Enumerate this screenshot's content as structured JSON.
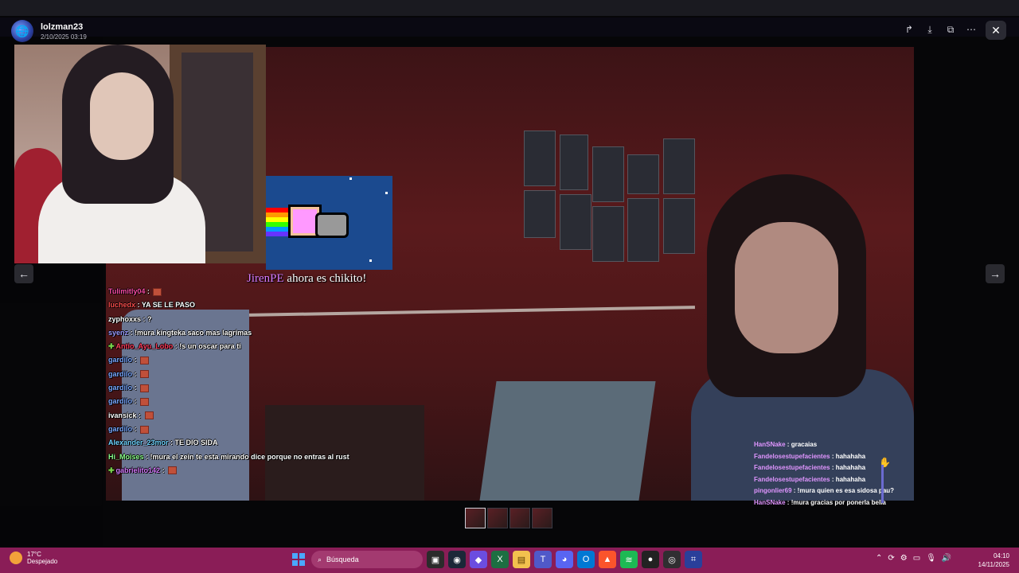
{
  "viewer": {
    "username": "lolzman23",
    "post_date": "2/10/2025 03:19",
    "actions": [
      "share-icon",
      "download-icon",
      "open-external-icon",
      "more-icon"
    ],
    "close_icon": "close-icon",
    "prev_icon": "arrow-left-icon",
    "next_icon": "arrow-right-icon"
  },
  "stream": {
    "alert": {
      "user": "JirenPE",
      "text": "ahora es chikito!"
    },
    "chat": [
      {
        "name": "Tulimitly04",
        "color": "#ff4da6",
        "text": "",
        "emote": true
      },
      {
        "name": "luchedx",
        "color": "#ff4d4d",
        "text": "YA SE LE PASO",
        "emote": false
      },
      {
        "name": "zyphoxxs",
        "color": "#ffffff",
        "text": "?",
        "emote": false
      },
      {
        "name": "syenz",
        "color": "#9a9aff",
        "text": "!mura kingteka saco mas lagrimas",
        "emote": false
      },
      {
        "name": "Antio_Ayu_Lobo",
        "color": "#ff3b5c",
        "text": "!s un oscar para ti",
        "emote": false,
        "badge": true
      },
      {
        "name": "gardilo",
        "color": "#7aa7ff",
        "text": "",
        "emote": true
      },
      {
        "name": "gardilo",
        "color": "#7aa7ff",
        "text": "",
        "emote": true
      },
      {
        "name": "gardilo",
        "color": "#7aa7ff",
        "text": "",
        "emote": true
      },
      {
        "name": "gardilo",
        "color": "#7aa7ff",
        "text": "",
        "emote": true
      },
      {
        "name": "ivansick",
        "color": "#ffffff",
        "text": "",
        "emote": true
      },
      {
        "name": "gardilo",
        "color": "#7aa7ff",
        "text": "",
        "emote": true
      },
      {
        "name": "Alexander_23mor",
        "color": "#6fd3ff",
        "text": "TE DIO SIDA",
        "emote": false
      },
      {
        "name": "Hi_Moises",
        "color": "#8cff8c",
        "text": "!mura el zein te esta mirando dice porque no entras al rust",
        "emote": false
      },
      {
        "name": "gabrielito142",
        "color": "#d67bff",
        "text": "",
        "emote": true,
        "badge": true
      }
    ],
    "chat_right": [
      {
        "name": "HanSNake",
        "text": "gracaias"
      },
      {
        "name": "Fandelosestupefacientes",
        "text": "hahahaha"
      },
      {
        "name": "Fandelosestupefacientes",
        "text": "hahahaha"
      },
      {
        "name": "Fandelosestupefacientes",
        "text": "hahahaha"
      },
      {
        "name": "pingonlier69",
        "text": "!mura quien es esa sidosa pau?"
      },
      {
        "name": "HanSNake",
        "text": "!mura gracias por ponerla bella"
      }
    ]
  },
  "thumbnails": 4,
  "taskbar": {
    "temp": "17°C",
    "weather": "Despejado",
    "search_placeholder": "Búsqueda",
    "time": "04:10",
    "date": "14/11/2025"
  }
}
